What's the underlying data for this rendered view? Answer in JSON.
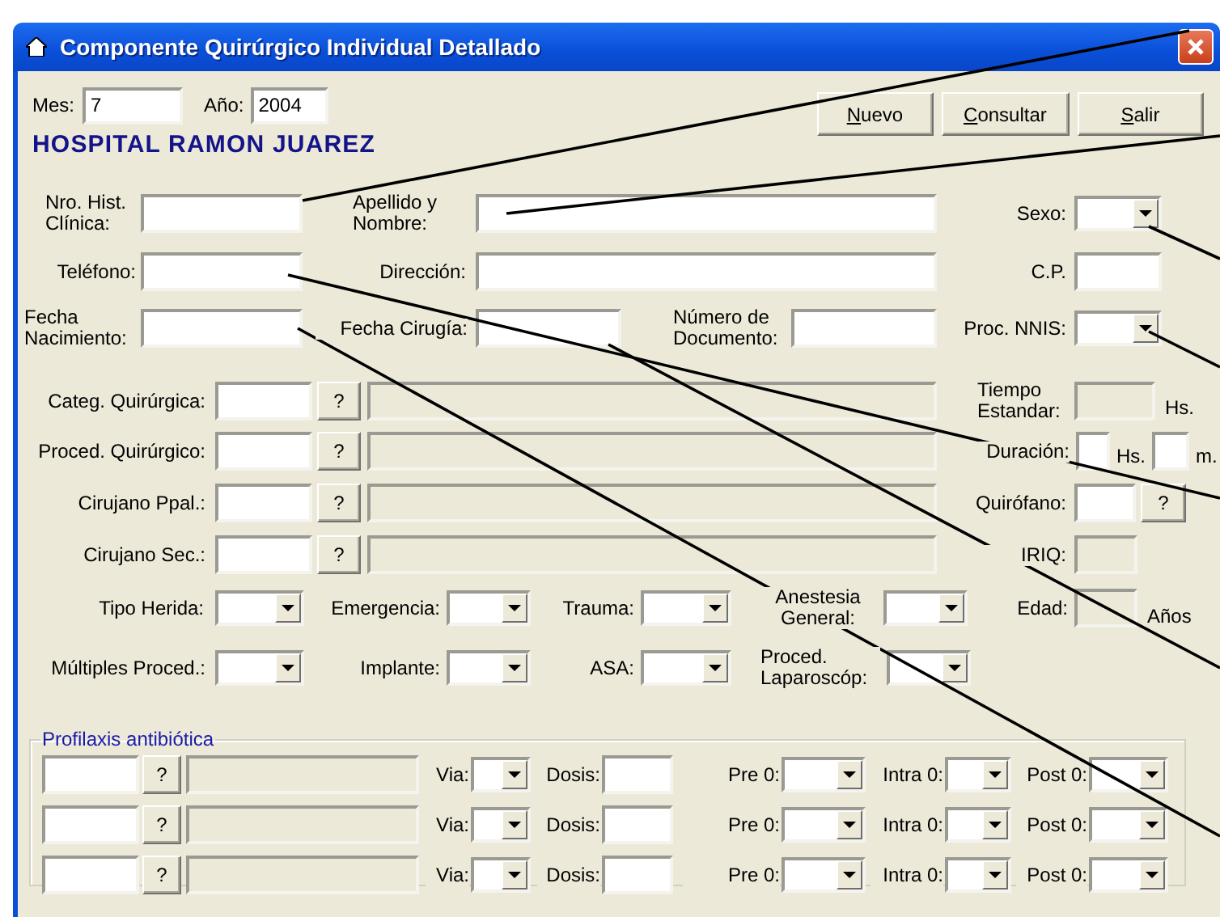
{
  "window": {
    "title": "Componente Quirúrgico Individual Detallado"
  },
  "period": [
    {
      "label": "Mes:",
      "value": "7"
    },
    {
      "label": "Año:",
      "value": "2004"
    }
  ],
  "buttons": [
    {
      "label": "Nuevo"
    },
    {
      "label": "Consultar"
    },
    {
      "label": "Salir"
    }
  ],
  "hospital": "HOSPITAL RAMON JUAREZ",
  "rows": [
    {
      "fields": [
        {
          "label": "Nro. Hist.\nClínica:",
          "kind": "text"
        },
        {
          "label": "Apellido y\nNombre:",
          "kind": "text"
        },
        {
          "label": "Sexo:",
          "kind": "combo"
        }
      ]
    },
    {
      "fields": [
        {
          "label": "Teléfono:",
          "kind": "text"
        },
        {
          "label": "Dirección:",
          "kind": "text"
        },
        {
          "label": "C.P.",
          "kind": "text"
        }
      ]
    },
    {
      "fields": [
        {
          "label": "Fecha\nNacimiento:",
          "kind": "text"
        },
        {
          "label": "Fecha Cirugía:",
          "kind": "text"
        },
        {
          "label": "Número de\nDocumento:",
          "kind": "text"
        },
        {
          "label": "Proc. NNIS:",
          "kind": "combo"
        }
      ]
    },
    {
      "fields": [
        {
          "label": "Categ. Quirúrgica:",
          "kind": "lookup",
          "button": "?"
        },
        {
          "label": "Tiempo\nEstandar:",
          "kind": "readonly",
          "unit": "Hs."
        }
      ]
    },
    {
      "fields": [
        {
          "label": "Proced. Quirúrgico:",
          "kind": "lookup",
          "button": "?"
        },
        {
          "label": "Duración:",
          "kind": "duration",
          "units": [
            "Hs.",
            "m."
          ]
        }
      ]
    },
    {
      "fields": [
        {
          "label": "Cirujano Ppal.:",
          "kind": "lookup",
          "button": "?"
        },
        {
          "label": "Quirófano:",
          "kind": "picker",
          "button": "?"
        }
      ]
    },
    {
      "fields": [
        {
          "label": "Cirujano Sec.:",
          "kind": "lookup",
          "button": "?"
        },
        {
          "label": "IRIQ:",
          "kind": "readonly"
        }
      ]
    },
    {
      "fields": [
        {
          "label": "Tipo Herida:",
          "kind": "combo"
        },
        {
          "label": "Emergencia:",
          "kind": "combo"
        },
        {
          "label": "Trauma:",
          "kind": "combo"
        },
        {
          "label": "Anestesia\nGeneral:",
          "kind": "combo"
        },
        {
          "label": "Edad:",
          "kind": "readonly",
          "unit": "Años"
        }
      ]
    },
    {
      "fields": [
        {
          "label": "Múltiples Proced.:",
          "kind": "combo"
        },
        {
          "label": "Implante:",
          "kind": "combo"
        },
        {
          "label": "ASA:",
          "kind": "combo"
        },
        {
          "label": "Proced.\nLaparoscóp:",
          "kind": "combo"
        }
      ]
    }
  ],
  "prophylaxis": {
    "title": "Profilaxis antibiótica",
    "rows": [
      {
        "button": "?",
        "via": "Via:",
        "dose": "Dosis:",
        "pre": "Pre 0:",
        "intra": "Intra 0:",
        "post": "Post 0:"
      },
      {
        "button": "?",
        "via": "Via:",
        "dose": "Dosis:",
        "pre": "Pre 0:",
        "intra": "Intra 0:",
        "post": "Post 0:"
      },
      {
        "button": "?",
        "via": "Via:",
        "dose": "Dosis:",
        "pre": "Pre 0:",
        "intra": "Intra 0:",
        "post": "Post 0:"
      }
    ]
  }
}
